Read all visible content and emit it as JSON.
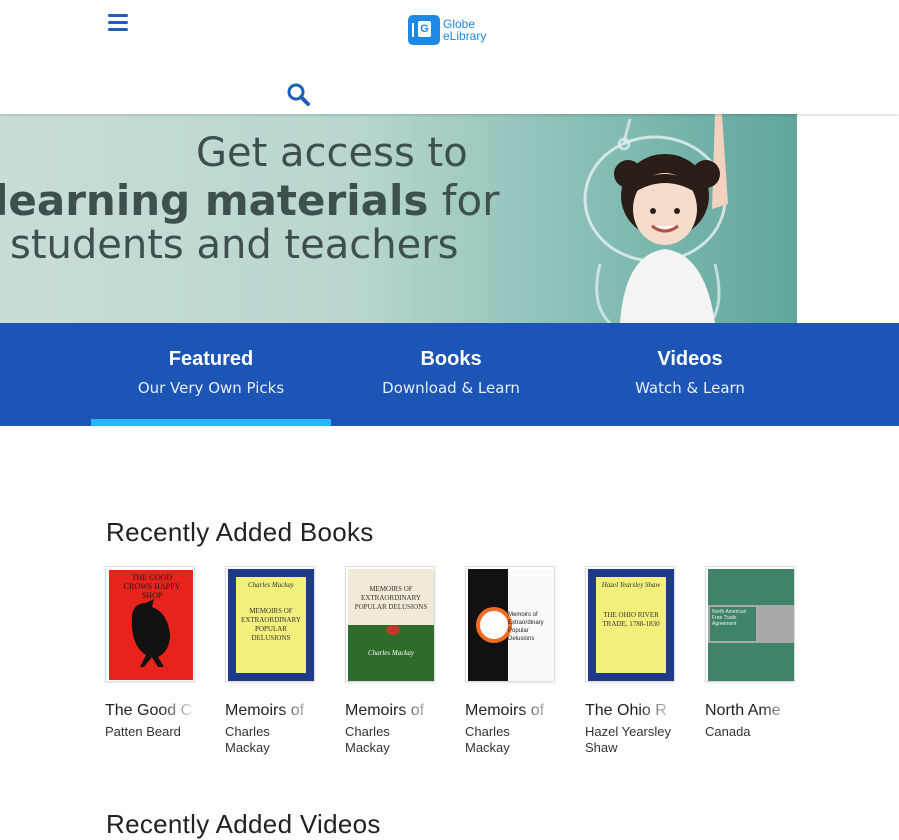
{
  "header": {
    "logo_line1": "Globe",
    "logo_line2": "eLibrary",
    "logo_glyph": "G",
    "menu_icon": "hamburger-menu-icon",
    "search_icon": "search-icon",
    "brand_color": "#1f5fb8"
  },
  "hero": {
    "line1": "Get access to",
    "line2_bold": "learning materials",
    "line2_rest": " for",
    "line3": "students and teachers"
  },
  "tabs": [
    {
      "label": "Featured",
      "sub": "Our Very Own Picks",
      "active": true
    },
    {
      "label": "Books",
      "sub": "Download & Learn",
      "active": false
    },
    {
      "label": "Videos",
      "sub": "Watch & Learn",
      "active": false
    }
  ],
  "sections": {
    "books_title": "Recently Added Books",
    "videos_title": "Recently Added Videos"
  },
  "books": [
    {
      "title": "The Good C",
      "author": "Patten Beard",
      "cover_color": "#e8231c"
    },
    {
      "title": "Memoirs of",
      "author": "Charles Mackay",
      "cover_color": "#1e3a8a"
    },
    {
      "title": "Memoirs of",
      "author": "Charles Mackay",
      "cover_color": "#2f6b2a"
    },
    {
      "title": "Memoirs of",
      "author": "Charles Mackay",
      "cover_color": "#f4f4f4"
    },
    {
      "title": "The Ohio R",
      "author": "Hazel Yearsley Shaw",
      "cover_color": "#1e3a8a"
    },
    {
      "title": "North Ame",
      "author": "Canada",
      "cover_color": "#3f8468"
    }
  ],
  "colors": {
    "tabbar": "#1c55b5",
    "tab_indicator": "#29b6f6"
  }
}
